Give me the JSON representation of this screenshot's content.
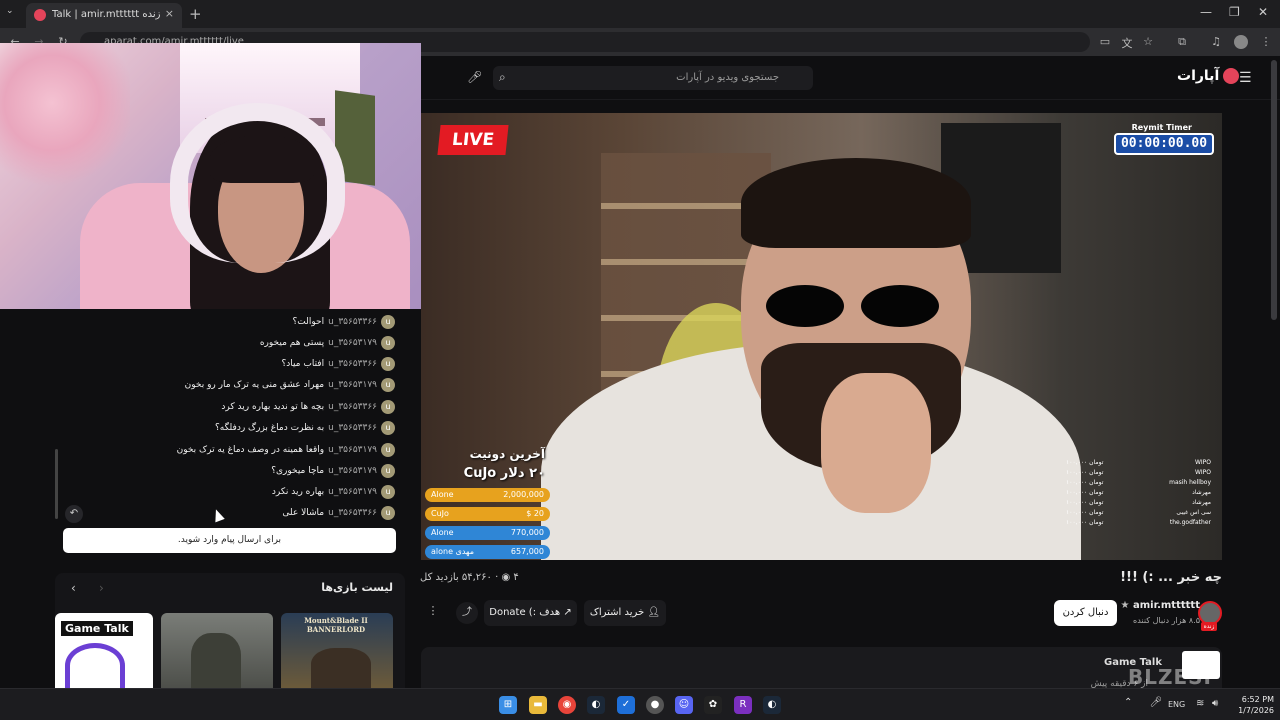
{
  "browser": {
    "tab_title": "Talk | amir.mtttttt پخش زنده",
    "url": "aparat.com/amir.mtttttt/live"
  },
  "header": {
    "logo_text": "آپارات",
    "search_placeholder": "جستجوی ویدیو در آپارات"
  },
  "chat": {
    "messages": [
      {
        "avatar": "u",
        "user": "u_۳۵۶۵۳۳۶۶",
        "text": "احوالت؟"
      },
      {
        "avatar": "u",
        "user": "u_۳۵۶۵۳۱۷۹",
        "text": "پستی هم میخوره"
      },
      {
        "avatar": "u",
        "user": "u_۳۵۶۵۳۳۶۶",
        "text": "افتاب میاد؟"
      },
      {
        "avatar": "u",
        "user": "u_۳۵۶۵۳۱۷۹",
        "text": "مهراد عشق منی یه ترک مار رو بخون"
      },
      {
        "avatar": "u",
        "user": "u_۳۵۶۵۳۳۶۶",
        "text": "بچه ها تو ندید بهاره رید کرد"
      },
      {
        "avatar": "u",
        "user": "u_۳۵۶۵۳۳۶۶",
        "text": "به نظرت دماغ بزرگ ردفلگه؟"
      },
      {
        "avatar": "u",
        "user": "u_۳۵۶۵۳۱۷۹",
        "text": "واقعا همینه در وصف دماغ یه ترک بخون"
      },
      {
        "avatar": "u",
        "user": "u_۳۵۶۵۳۱۷۹",
        "text": "ماچا میخوری؟"
      },
      {
        "avatar": "u",
        "user": "u_۳۵۶۵۳۱۷۹",
        "text": "بهاره رید نکرد"
      },
      {
        "avatar": "u",
        "user": "u_۳۵۶۵۳۳۶۶",
        "text": "ماشالا علی"
      }
    ],
    "login_prompt": "برای ارسال پیام وارد شوید."
  },
  "games": {
    "title": "لیست بازی‌ها",
    "items": [
      {
        "name": "Game Talk"
      },
      {
        "name": ""
      },
      {
        "name": "Mount&Blade II BANNERLORD"
      }
    ]
  },
  "video": {
    "live_label": "LIVE",
    "timer_label": "Reymit Timer",
    "timer_value": "00:00:00.00",
    "donate_header": "آخرین دونیت",
    "donate_last": "۲۰ دلار CuJo",
    "donate_bars": [
      {
        "name": "Alone",
        "amount": "2,000,000",
        "color": "#e7a21e"
      },
      {
        "name": "CuJo",
        "amount": "$ 20",
        "color": "#e7a21e"
      },
      {
        "name": "Alone",
        "amount": "770,000",
        "color": "#2f86d6"
      },
      {
        "name": "alone مهدی",
        "amount": "657,000",
        "color": "#2f86d6"
      }
    ],
    "top_donors": [
      {
        "name": "WIPO",
        "amount": "۱۰۰,۰۰۰ تومان"
      },
      {
        "name": "WIPO",
        "amount": "۱۰۰,۰۰۰ تومان"
      },
      {
        "name": "masih hellboy",
        "amount": "۱۰۰,۰۰۰ تومان"
      },
      {
        "name": "مهرشاد",
        "amount": "۱۰۰,۰۰۰ تومان"
      },
      {
        "name": "مهرشاد",
        "amount": "۱۰۰,۰۰۰ تومان"
      },
      {
        "name": "سی اس غیبی",
        "amount": "۱۰۰,۰۰۰ تومان"
      },
      {
        "name": "the.godfather",
        "amount": "۱۰۰,۰۰۰ تومان"
      }
    ]
  },
  "info": {
    "title": "چه خبر ... :) !!!",
    "views": "۵۴,۲۶۰ بازدید کل",
    "viewers": "۴",
    "channel_name": "amir.mtttttt",
    "channel_followers": "۸.۵ هزار دنبال کننده",
    "channel_live": "زنده",
    "follow_label": "دنبال کردن",
    "subscribe_label": "خرید اشتراک",
    "donate_label": "هدف :) Donate",
    "desc_chip": "Game Talk",
    "desc_time": "از ۶ دقیقه پیش"
  },
  "watermark": "BLZESP",
  "taskbar": {
    "lang": "ENG",
    "time": "6:52 PM",
    "date": "1/7/2026"
  }
}
